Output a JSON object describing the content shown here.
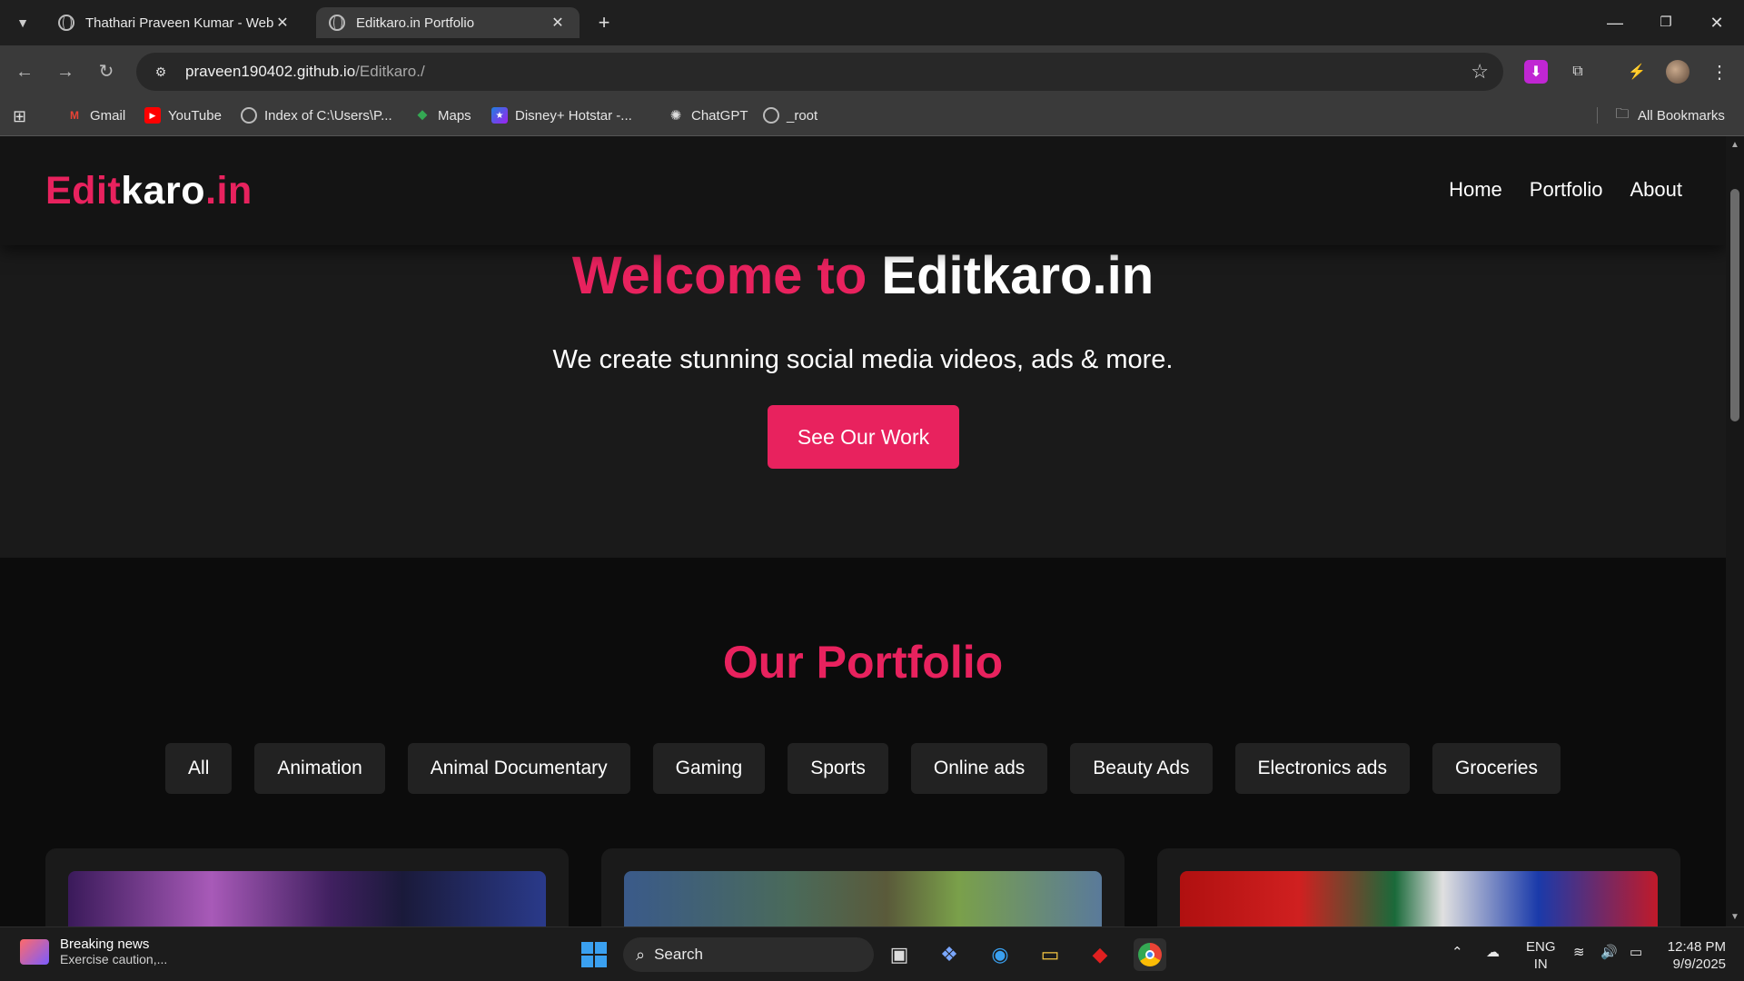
{
  "browser": {
    "tabs": [
      {
        "title": "Thathari Praveen Kumar - Web D",
        "active": false
      },
      {
        "title": "Editkaro.in Portfolio",
        "active": true
      }
    ],
    "url_host": "praveen190402.github.io",
    "url_path": "/Editkaro./",
    "bookmarks": [
      {
        "label": "Gmail",
        "icon": "gmail-icon"
      },
      {
        "label": "YouTube",
        "icon": "youtube-icon"
      },
      {
        "label": "Index of C:\\Users\\P...",
        "icon": "globe-icon"
      },
      {
        "label": "Maps",
        "icon": "maps-icon"
      },
      {
        "label": "Disney+ Hotstar -...",
        "icon": "hotstar-icon"
      },
      {
        "label": "ChatGPT",
        "icon": "chatgpt-icon"
      },
      {
        "label": "_root",
        "icon": "globe-icon"
      }
    ],
    "all_bookmarks": "All Bookmarks"
  },
  "site": {
    "logo": {
      "part1": "Edit",
      "part2": "karo",
      "part3": ".in"
    },
    "nav": [
      "Home",
      "Portfolio",
      "About"
    ],
    "hero": {
      "title_pink": "Welcome to",
      "title_white": "Editkaro.in",
      "subtitle": "We create stunning social media videos, ads & more.",
      "cta": "See Our Work"
    },
    "portfolio": {
      "title": "Our Portfolio",
      "filters": [
        "All",
        "Animation",
        "Animal Documentary",
        "Gaming",
        "Sports",
        "Online ads",
        "Beauty Ads",
        "Electronics ads",
        "Groceries"
      ]
    }
  },
  "taskbar": {
    "news_title": "Breaking news",
    "news_sub": "Exercise caution,...",
    "search": "Search",
    "lang1": "ENG",
    "lang2": "IN",
    "time": "12:48 PM",
    "date": "9/9/2025"
  },
  "colors": {
    "accent": "#e8225e",
    "bg": "#0c0c0c",
    "hero_bg": "#1a1a1a"
  }
}
